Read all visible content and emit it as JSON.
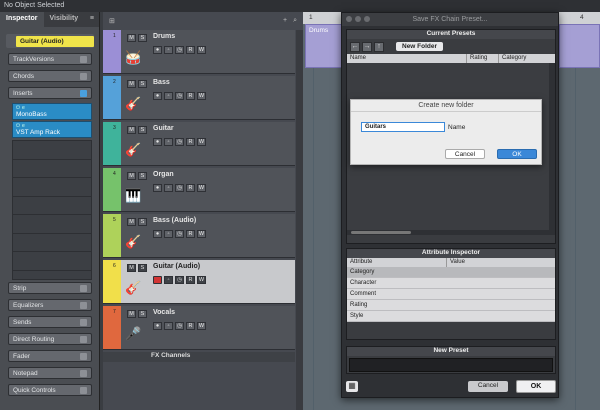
{
  "topbar": {
    "status": "No Object Selected"
  },
  "inspector": {
    "tabs": [
      "Inspector",
      "Visibility"
    ],
    "track_name": "Guitar (Audio)",
    "sections_top": [
      "TrackVersions",
      "Chords",
      "Inserts"
    ],
    "inserts": [
      {
        "label": "MonoBass"
      },
      {
        "label": "VST Amp Rack"
      }
    ],
    "sections_bottom": [
      "Strip",
      "Equalizers",
      "Sends",
      "Direct Routing",
      "Fader",
      "Notepad",
      "Quick Controls"
    ]
  },
  "tracks": [
    {
      "num": "1",
      "name": "Drums",
      "color": "#9b8fd6",
      "icon": "🥁"
    },
    {
      "num": "2",
      "name": "Bass",
      "color": "#55a1d9",
      "icon": "🎸"
    },
    {
      "num": "3",
      "name": "Guitar",
      "color": "#3fb39b",
      "icon": "🎸"
    },
    {
      "num": "4",
      "name": "Organ",
      "color": "#76c26b",
      "icon": "🎹"
    },
    {
      "num": "5",
      "name": "Bass (Audio)",
      "color": "#aed25a",
      "icon": "🎸"
    },
    {
      "num": "6",
      "name": "Guitar (Audio)",
      "color": "#f1df4a",
      "icon": "🎸"
    },
    {
      "num": "7",
      "name": "Vocals",
      "color": "#e0683e",
      "icon": "🎤"
    }
  ],
  "track_buttons": {
    "mute": "M",
    "solo": "S",
    "rec": "●",
    "read": "R",
    "write": "W"
  },
  "fx_channels": "FX Channels",
  "arrange": {
    "ruler": [
      "1",
      "4"
    ],
    "part_label": "Drums"
  },
  "dialog": {
    "title": "Save FX Chain Preset...",
    "current_presets": "Current Presets",
    "new_folder_button": "New Folder",
    "columns": [
      "Name",
      "Rating",
      "Category"
    ],
    "attribute_inspector": "Attribute Inspector",
    "attr_columns": [
      "Attribute",
      "Value"
    ],
    "attributes": [
      "Category",
      "Character",
      "Comment",
      "Rating",
      "Style"
    ],
    "new_preset": "New Preset",
    "cancel": "Cancel",
    "ok": "OK"
  },
  "subdialog": {
    "title": "Create new folder",
    "input_value": "Guitars",
    "label": "Name",
    "cancel": "Cancel",
    "ok": "OK"
  }
}
